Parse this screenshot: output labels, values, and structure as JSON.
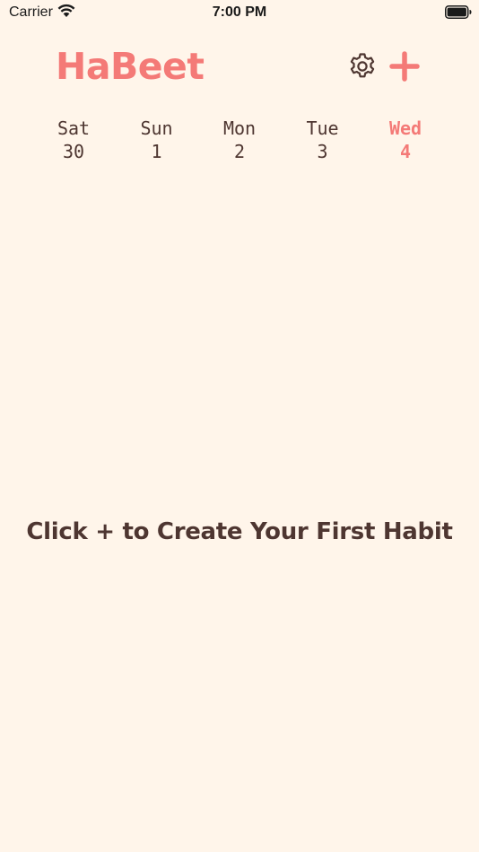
{
  "status_bar": {
    "carrier": "Carrier",
    "time": "7:00 PM"
  },
  "header": {
    "title": "HaBeet",
    "settings_icon": "gear-icon",
    "add_icon": "plus-icon"
  },
  "days": [
    {
      "name": "Sat",
      "number": "30",
      "active": false
    },
    {
      "name": "Sun",
      "number": "1",
      "active": false
    },
    {
      "name": "Mon",
      "number": "2",
      "active": false
    },
    {
      "name": "Tue",
      "number": "3",
      "active": false
    },
    {
      "name": "Wed",
      "number": "4",
      "active": true
    }
  ],
  "empty_state": {
    "message": "Click + to Create Your First Habit"
  },
  "colors": {
    "background": "#fff5ea",
    "accent": "#f47a77",
    "text": "#4e3631"
  }
}
